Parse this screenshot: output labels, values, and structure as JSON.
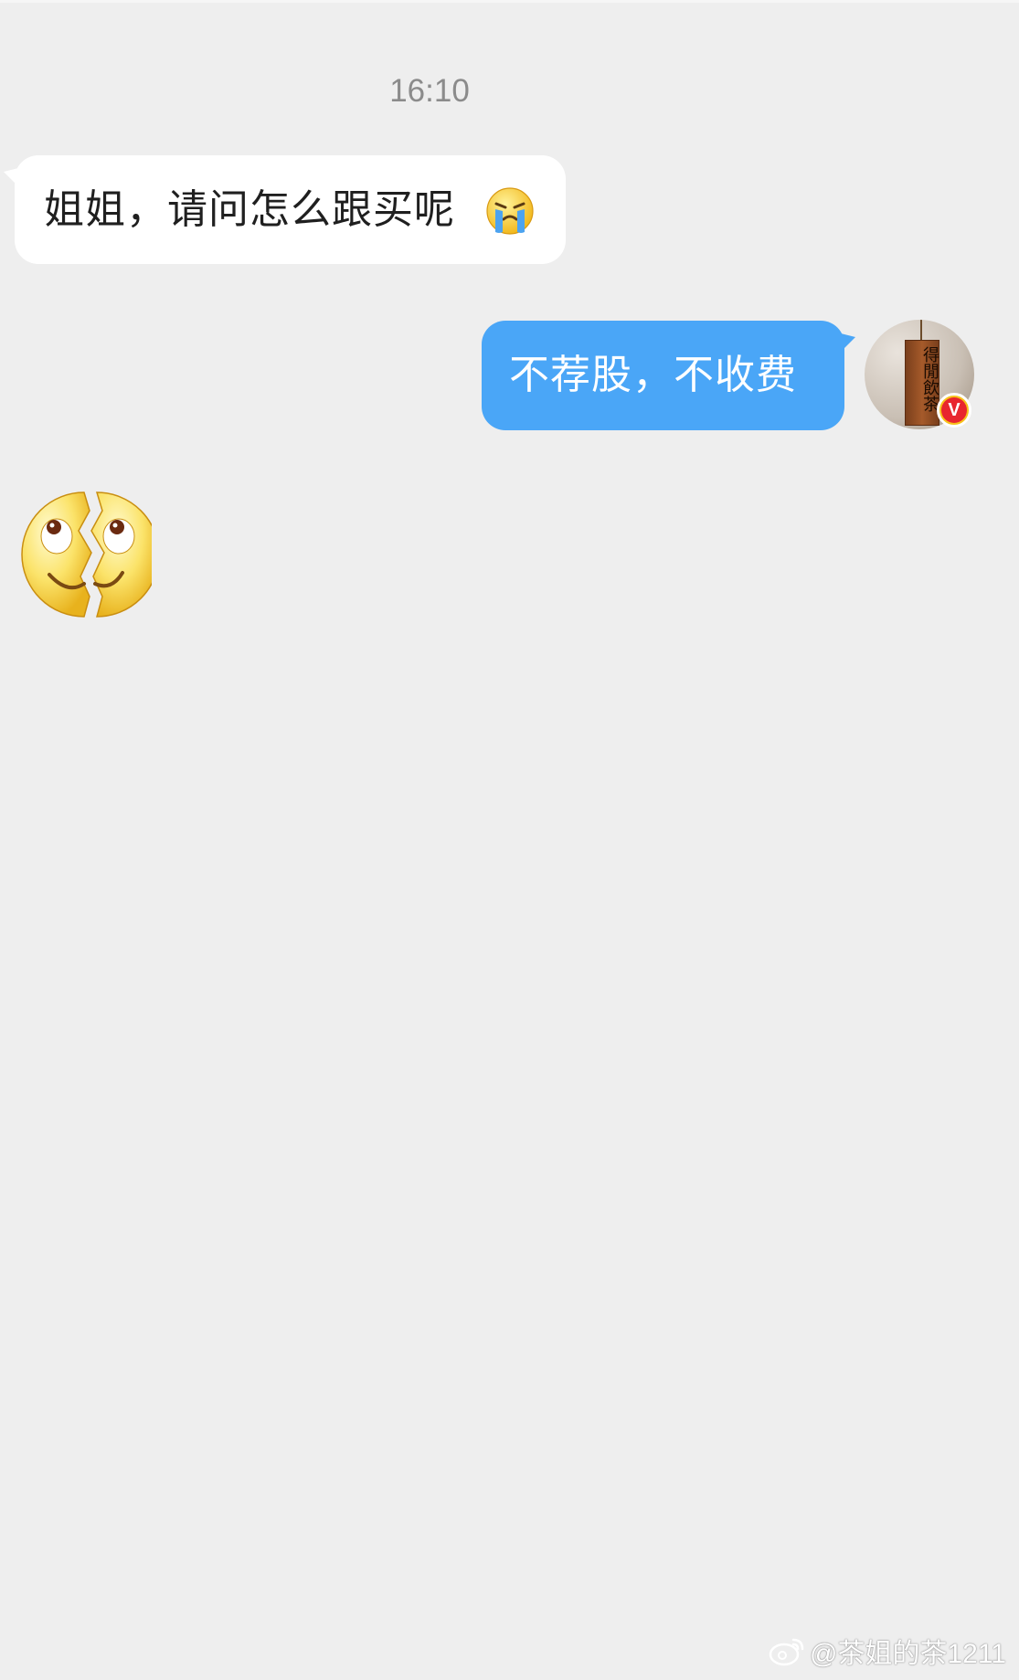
{
  "chat": {
    "timestamp": "16:10",
    "incoming_message": "姐姐，请问怎么跟买呢",
    "outgoing_message": "不荐股，不收费"
  },
  "avatar": {
    "plaque_text": "得閒飲茶",
    "badge_letter": "V"
  },
  "icons": {
    "crying": "crying-face-icon",
    "broken_smile": "broken-smile-emoji-icon",
    "weibo": "weibo-logo-icon"
  },
  "watermark": {
    "text": "@茶姐的茶1211"
  },
  "colors": {
    "background": "#eeeeee",
    "incoming_bubble": "#ffffff",
    "outgoing_bubble": "#4aa6f7",
    "badge_outer": "#f7c21a",
    "badge_inner": "#e8262e"
  }
}
